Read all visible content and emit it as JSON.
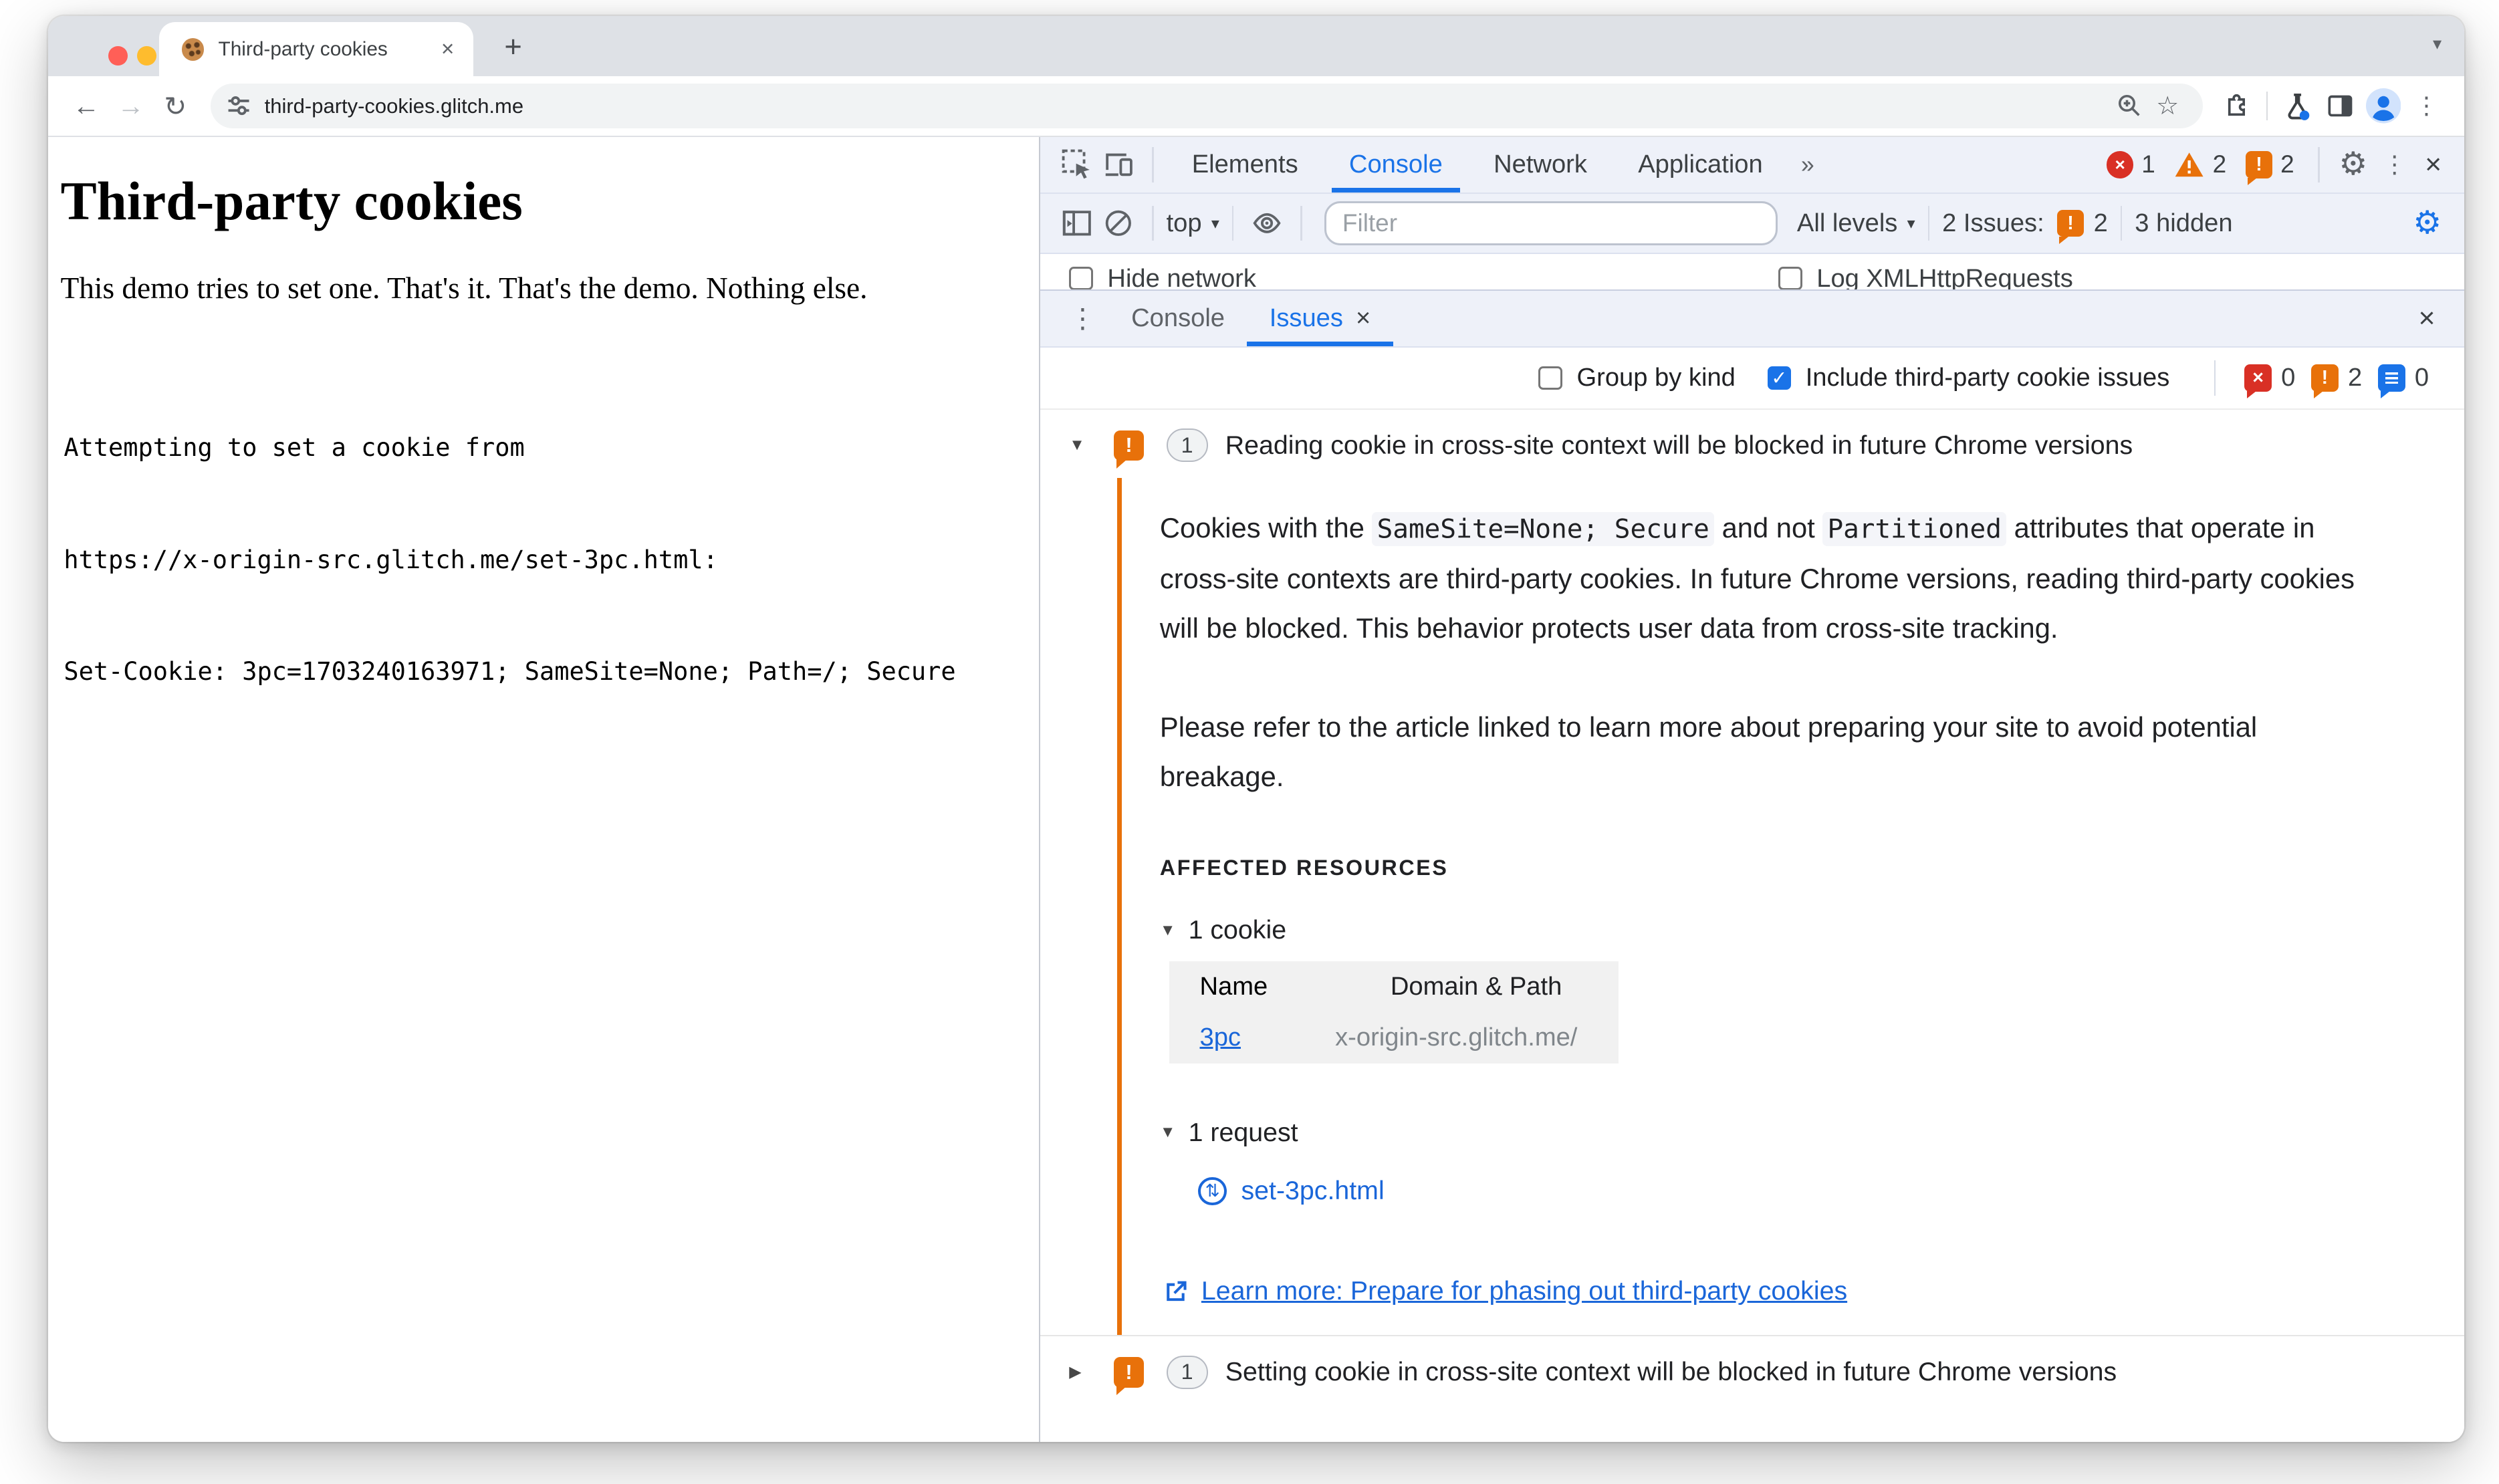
{
  "colors": {
    "accent": "#1a73e8",
    "issue_orange": "#e8710a",
    "error_red": "#d93025",
    "link_blue": "#1a66d9"
  },
  "icons": {
    "close": "×",
    "new_tab": "+",
    "back": "←",
    "forward": "→",
    "reload": "↻",
    "star": "☆",
    "more_tabs": "»",
    "kebab": "⋮",
    "gear": "⚙",
    "chevron_down": "▾",
    "tri_down": "▼",
    "tri_right": "▶",
    "updown": "⇅",
    "check": "✓",
    "exclaim": "!",
    "error_x": "×"
  },
  "browser": {
    "tab_title": "Third-party cookies",
    "url": "third-party-cookies.glitch.me"
  },
  "page": {
    "title": "Third-party cookies",
    "lede": "This demo tries to set one. That's it. That's the demo. Nothing else.",
    "code_line1": "Attempting to set a cookie from",
    "code_line2": "https://x-origin-src.glitch.me/set-3pc.html:",
    "code_line3": "Set-Cookie: 3pc=1703240163971; SameSite=None; Path=/; Secure"
  },
  "devtools": {
    "tabs": [
      "Elements",
      "Console",
      "Network",
      "Application"
    ],
    "badges": {
      "errors": "1",
      "warnings": "2",
      "issues": "2"
    },
    "console_toolbar": {
      "context": "top",
      "filter_placeholder": "Filter",
      "levels": "All levels",
      "issues_summary": "2 Issues:",
      "issues_count": "2",
      "hidden": "3 hidden"
    },
    "console_settings": {
      "hide_network": "Hide network",
      "log_xhr": "Log XMLHttpRequests"
    },
    "drawer": {
      "console_tab": "Console",
      "issues_tab": "Issues"
    },
    "issues_toolbar": {
      "group_by_kind": "Group by kind",
      "include_third_party": "Include third-party cookie issues",
      "counts": {
        "errors": "0",
        "warnings": "2",
        "info": "0"
      }
    },
    "issues": [
      {
        "count": "1",
        "title": "Reading cookie in cross-site context will be blocked in future Chrome versions",
        "description_parts": [
          {
            "type": "text",
            "value": "Cookies with the "
          },
          {
            "type": "code",
            "value": "SameSite=None; Secure"
          },
          {
            "type": "text",
            "value": " and not "
          },
          {
            "type": "code",
            "value": "Partitioned"
          },
          {
            "type": "text",
            "value": " attributes that operate in cross-site contexts are third-party cookies. In future Chrome versions, reading third-party cookies will be blocked. This behavior protects user data from cross-site tracking."
          }
        ],
        "note": "Please refer to the article linked to learn more about preparing your site to avoid potential breakage.",
        "affected_label": "AFFECTED RESOURCES",
        "cookie_group": "1 cookie",
        "table": {
          "name_header": "Name",
          "domain_header": "Domain & Path",
          "cookie_name": "3pc",
          "cookie_domain": "x-origin-src.glitch.me/"
        },
        "request_group": "1 request",
        "request_name": "set-3pc.html",
        "learn_more": "Learn more: Prepare for phasing out third-party cookies"
      },
      {
        "count": "1",
        "title": "Setting cookie in cross-site context will be blocked in future Chrome versions"
      }
    ]
  }
}
